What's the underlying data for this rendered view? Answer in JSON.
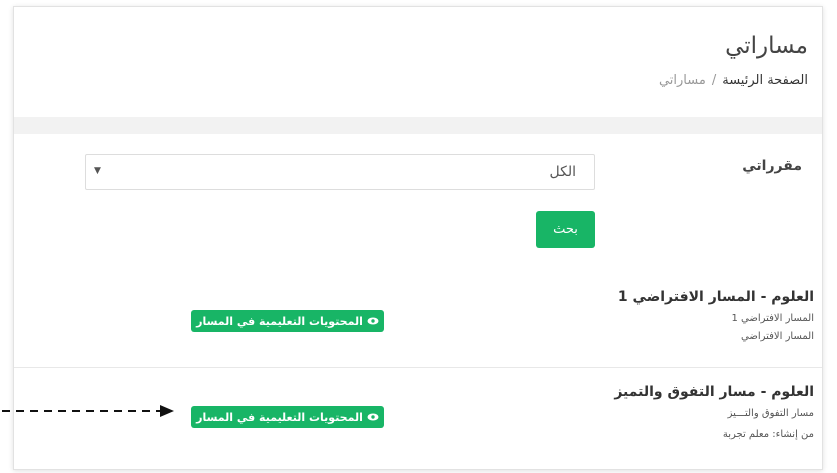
{
  "header": {
    "title": "مساراتي",
    "breadcrumb": {
      "home": "الصفحة الرئيسة",
      "separator": "/",
      "current": "مساراتي"
    }
  },
  "filter": {
    "label": "مقرراتي",
    "selected": "الكل",
    "search_button": "بحث"
  },
  "tracks": [
    {
      "title": "العلوم - المسار الافتراضي 1",
      "line1": "المسار الافتراضي 1",
      "line2": "المسار الافتراضي",
      "button": "المحتويات التعليمية في المسار"
    },
    {
      "title": "العلوم - مسار التفوق والتميز",
      "line1": "مسار التفوق والتـــيز",
      "line2": "من إنشاء: معلم تجربة",
      "button": "المحتويات التعليمية في المسار"
    }
  ],
  "colors": {
    "accent": "#18b566",
    "band": "#f2f2f2"
  }
}
